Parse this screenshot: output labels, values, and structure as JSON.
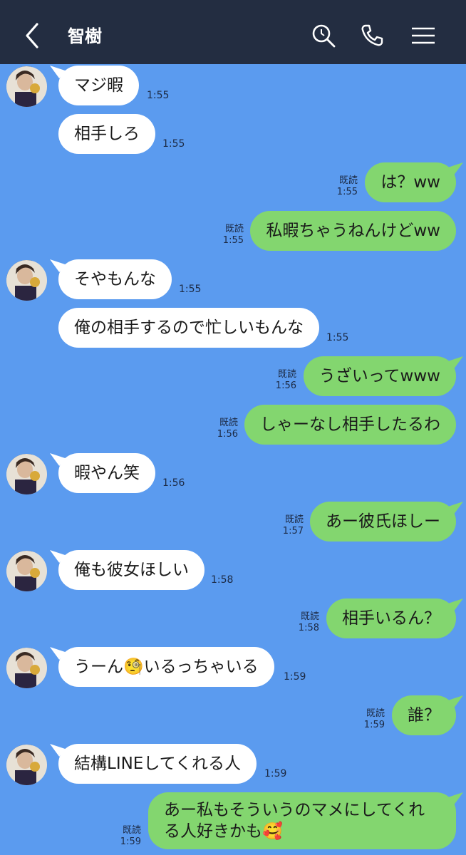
{
  "header": {
    "title": "智樹",
    "icons": [
      "chevron-left-icon",
      "search-icon",
      "phone-icon",
      "menu-icon"
    ]
  },
  "messages": [
    {
      "side": "in",
      "text": "マジ暇",
      "time": "1:55"
    },
    {
      "side": "in",
      "text": "相手しろ",
      "time": "1:55"
    },
    {
      "side": "out",
      "text": "は？ww",
      "read": "既読",
      "time": "1:55"
    },
    {
      "side": "out",
      "text": "私暇ちゃうねんけどww",
      "read": "既読",
      "time": "1:55"
    },
    {
      "side": "in",
      "text": "そやもんな",
      "time": "1:55"
    },
    {
      "side": "in",
      "text": "俺の相手するので忙しいもんな",
      "time": "1:55"
    },
    {
      "side": "out",
      "text": "うざいってwww",
      "read": "既読",
      "time": "1:56"
    },
    {
      "side": "out",
      "text": "しゃーなし相手したるわ",
      "read": "既読",
      "time": "1:56"
    },
    {
      "side": "in",
      "text": "暇やん笑",
      "time": "1:56"
    },
    {
      "side": "out",
      "text": "あー彼氏ほしー",
      "read": "既読",
      "time": "1:57"
    },
    {
      "side": "in",
      "text": "俺も彼女ほしい",
      "time": "1:58"
    },
    {
      "side": "out",
      "text": "相手いるん？",
      "read": "既読",
      "time": "1:58"
    },
    {
      "side": "in",
      "text": "うーん🧐いるっちゃいる",
      "time": "1:59"
    },
    {
      "side": "out",
      "text": "誰？",
      "read": "既読",
      "time": "1:59"
    },
    {
      "side": "in",
      "text": "結構LINEしてくれる人",
      "time": "1:59"
    },
    {
      "side": "out",
      "text": "あー私もそういうのマメにしてくれる人好きかも🥰",
      "read": "既読",
      "time": "1:59"
    }
  ]
}
